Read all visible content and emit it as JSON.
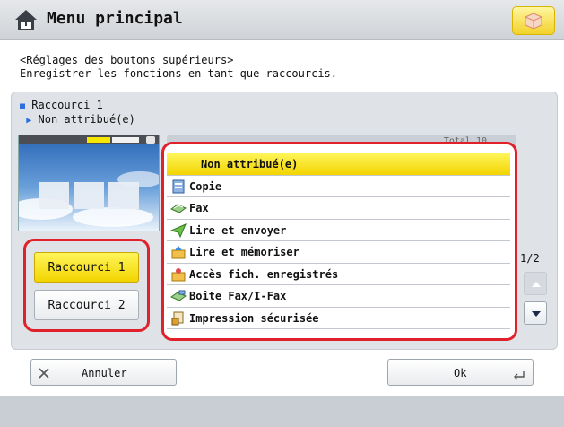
{
  "header": {
    "title": "Menu principal"
  },
  "instructions": {
    "line1": "<Réglages des boutons supérieurs>",
    "line2": "Enregistrer les fonctions en tant que raccourcis."
  },
  "shortcut_info": {
    "name": "Raccourci 1",
    "value": "Non attribué(e)"
  },
  "shortcut_buttons": [
    {
      "label": "Raccourci 1",
      "selected": true
    },
    {
      "label": "Raccourci 2",
      "selected": false
    }
  ],
  "list": {
    "total_label": "Total 10",
    "items": [
      {
        "label": "Non attribué(e)",
        "selected": true,
        "icon": "none"
      },
      {
        "label": "Copie",
        "selected": false,
        "icon": "copy-icon"
      },
      {
        "label": "Fax",
        "selected": false,
        "icon": "fax-icon"
      },
      {
        "label": "Lire et envoyer",
        "selected": false,
        "icon": "scan-send-icon"
      },
      {
        "label": "Lire et mémoriser",
        "selected": false,
        "icon": "scan-store-icon"
      },
      {
        "label": "Accès fich. enregistrés",
        "selected": false,
        "icon": "stored-files-icon"
      },
      {
        "label": "Boîte Fax/I-Fax",
        "selected": false,
        "icon": "fax-inbox-icon"
      },
      {
        "label": "Impression sécurisée",
        "selected": false,
        "icon": "secure-print-icon"
      }
    ]
  },
  "pagination": {
    "label": "1/2"
  },
  "buttons": {
    "cancel": "Annuler",
    "ok": "Ok"
  },
  "colors": {
    "selected": "#f5e000",
    "highlight_border": "#e0202a",
    "panel": "#dfe3e8"
  }
}
